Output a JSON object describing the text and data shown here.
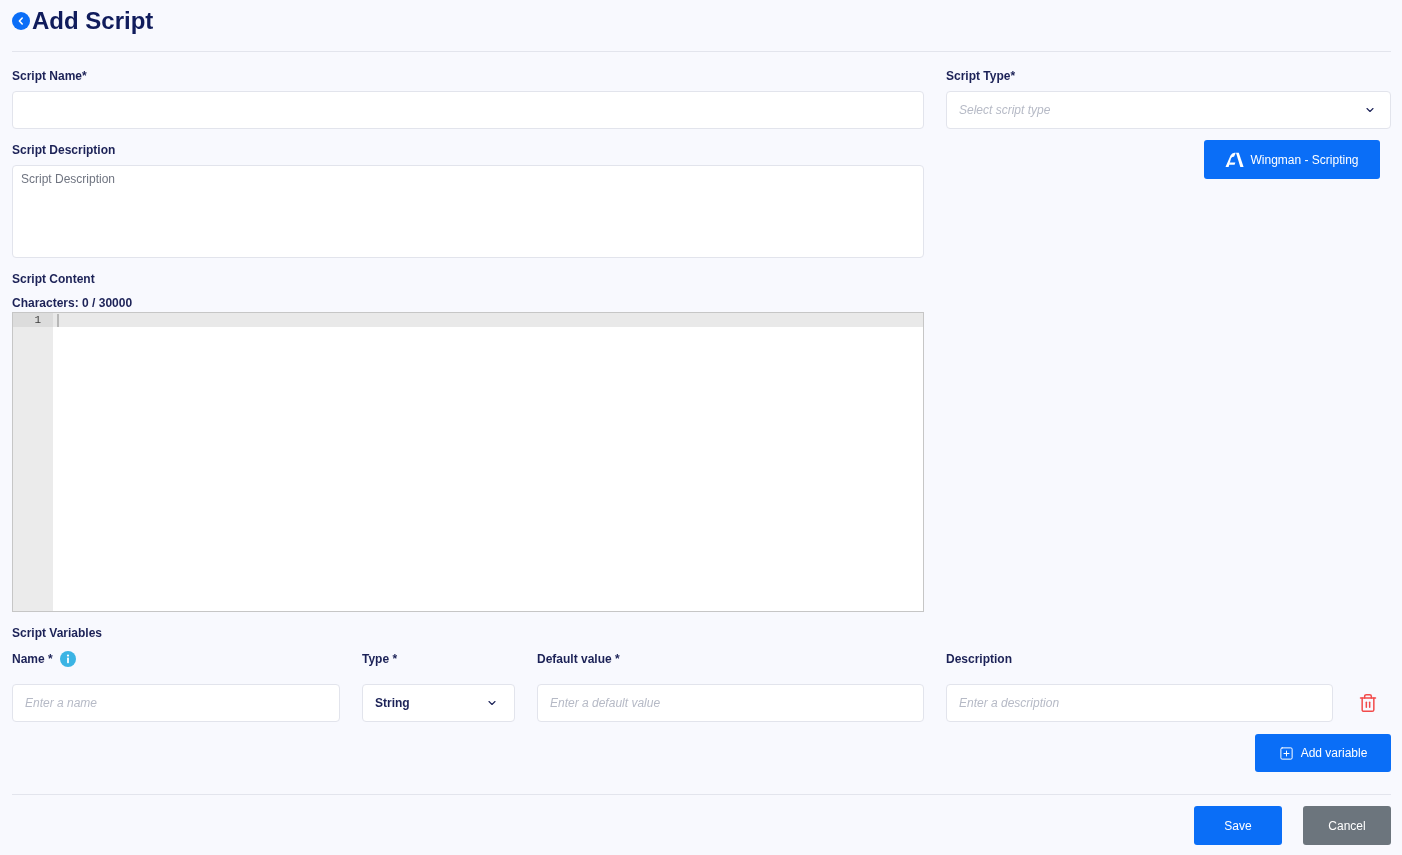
{
  "header": {
    "title": "Add Script"
  },
  "script_name": {
    "label": "Script Name*"
  },
  "script_type": {
    "label": "Script Type*",
    "placeholder": "Select script type"
  },
  "wingman_button": {
    "label": "Wingman - Scripting"
  },
  "script_description": {
    "label": "Script Description",
    "placeholder": "Script Description"
  },
  "script_content": {
    "label": "Script Content",
    "counter": "Characters: 0 / 30000",
    "line_numbers": [
      "1"
    ]
  },
  "script_variables": {
    "title": "Script Variables",
    "headers": {
      "name": "Name *",
      "type": "Type *",
      "default_value": "Default value *",
      "description": "Description"
    },
    "rows": [
      {
        "name": {
          "placeholder": "Enter a name"
        },
        "type": {
          "value": "String"
        },
        "default_value": {
          "placeholder": "Enter a default value"
        },
        "description": {
          "placeholder": "Enter a description"
        }
      }
    ],
    "add_button": {
      "label": "Add variable"
    }
  },
  "actions": [
    {
      "label": "Save",
      "kind": "primary"
    },
    {
      "label": "Cancel",
      "kind": "secondary"
    }
  ]
}
